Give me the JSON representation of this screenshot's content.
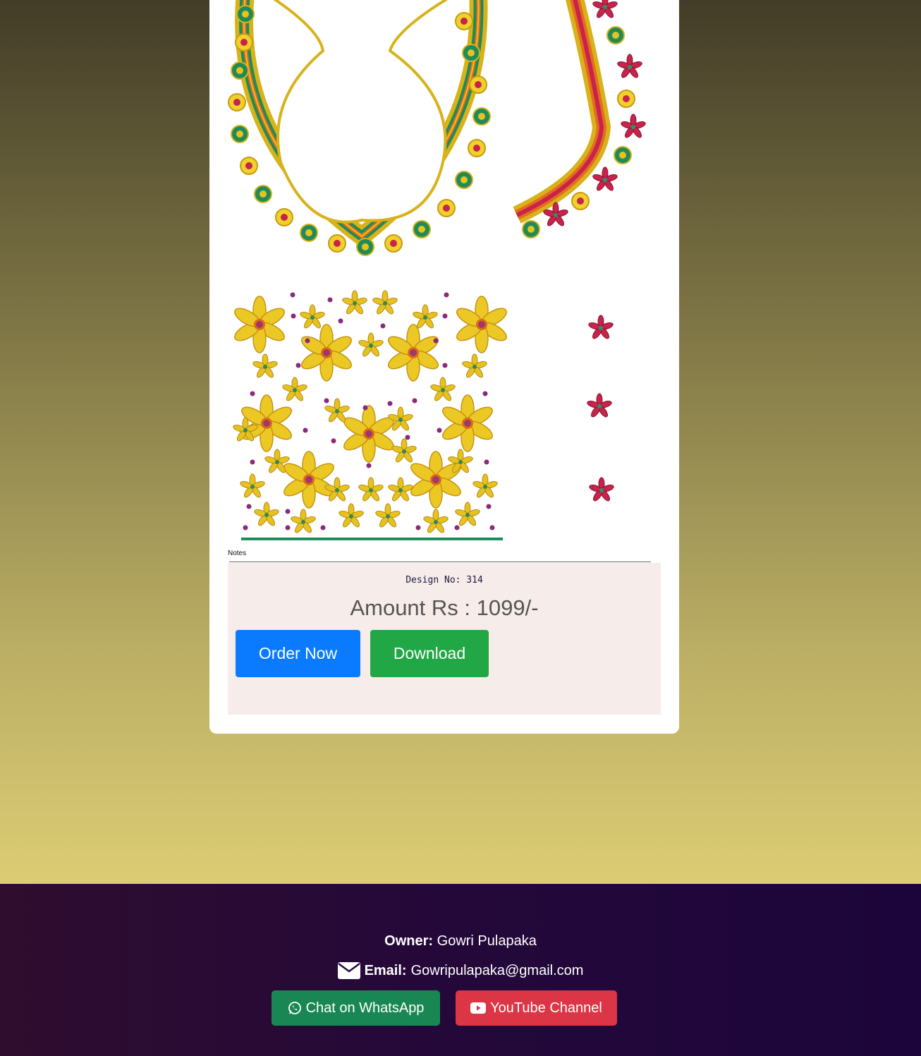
{
  "artwork": {
    "notes_label": "Notes"
  },
  "product": {
    "design_no": "Design No: 314",
    "amount": "Amount Rs : 1099/-",
    "order_label": "Order Now",
    "download_label": "Download"
  },
  "footer": {
    "owner_label": "Owner:",
    "owner_name": "Gowri Pulapaka",
    "email_icon": "envelope-icon",
    "email_label": "Email:",
    "email_value": "Gowripulapaka@gmail.com",
    "whatsapp_icon": "whatsapp-icon",
    "whatsapp_label": "Chat on WhatsApp",
    "youtube_icon": "youtube-icon",
    "youtube_label": "YouTube Channel"
  },
  "colors": {
    "order_button": "#0a7bff",
    "download_button": "#21a745",
    "whatsapp_button": "#198754",
    "youtube_button": "#dc3545"
  }
}
